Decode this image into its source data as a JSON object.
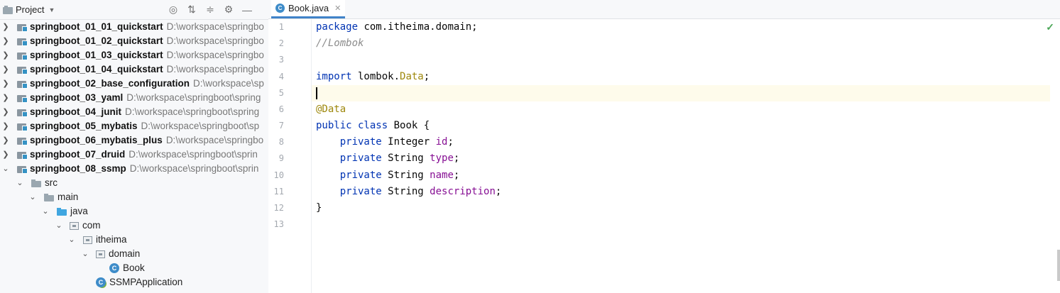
{
  "project_panel": {
    "title": "Project",
    "tools": [
      "target-icon",
      "expand-all-icon",
      "collapse-all-icon",
      "gear-icon",
      "minimize-icon"
    ]
  },
  "tree": [
    {
      "name": "springboot_01_01_quickstart",
      "path": "D:\\workspace\\springbo",
      "expanded": false
    },
    {
      "name": "springboot_01_02_quickstart",
      "path": "D:\\workspace\\springbo",
      "expanded": false
    },
    {
      "name": "springboot_01_03_quickstart",
      "path": "D:\\workspace\\springbo",
      "expanded": false
    },
    {
      "name": "springboot_01_04_quickstart",
      "path": "D:\\workspace\\springbo",
      "expanded": false
    },
    {
      "name": "springboot_02_base_configuration",
      "path": "D:\\workspace\\sp",
      "expanded": false
    },
    {
      "name": "springboot_03_yaml",
      "path": "D:\\workspace\\springboot\\spring",
      "expanded": false
    },
    {
      "name": "springboot_04_junit",
      "path": "D:\\workspace\\springboot\\spring",
      "expanded": false
    },
    {
      "name": "springboot_05_mybatis",
      "path": "D:\\workspace\\springboot\\sp",
      "expanded": false
    },
    {
      "name": "springboot_06_mybatis_plus",
      "path": "D:\\workspace\\springbo",
      "expanded": false
    },
    {
      "name": "springboot_07_druid",
      "path": "D:\\workspace\\springboot\\sprin",
      "expanded": false
    },
    {
      "name": "springboot_08_ssmp",
      "path": "D:\\workspace\\springboot\\sprin",
      "expanded": true
    }
  ],
  "subtree": {
    "src": "src",
    "main": "main",
    "java": "java",
    "com": "com",
    "itheima": "itheima",
    "domain": "domain",
    "book": "Book",
    "app": "SSMPApplication"
  },
  "editor": {
    "tab": "Book.java",
    "line_numbers": [
      "1",
      "2",
      "3",
      "4",
      "5",
      "6",
      "7",
      "8",
      "9",
      "10",
      "11",
      "12",
      "13"
    ],
    "status_check": "✓",
    "code": {
      "l1_kw": "package",
      "l1_rest": " com.itheima.domain;",
      "l2": "//Lombok",
      "l4_kw": "import",
      "l4_mid": " lombok.",
      "l4_cls": "Data",
      "l4_end": ";",
      "l6": "@Data",
      "l7_kw": "public class",
      "l7_rest": " Book {",
      "field_kw": "private",
      "f1_type": " Integer ",
      "f1_name": "id",
      "f2_type": " String ",
      "f2_name": "type",
      "f3_type": " String ",
      "f3_name": "name",
      "f4_type": " String ",
      "f4_name": "description",
      "semi": ";",
      "l12": "}"
    }
  }
}
